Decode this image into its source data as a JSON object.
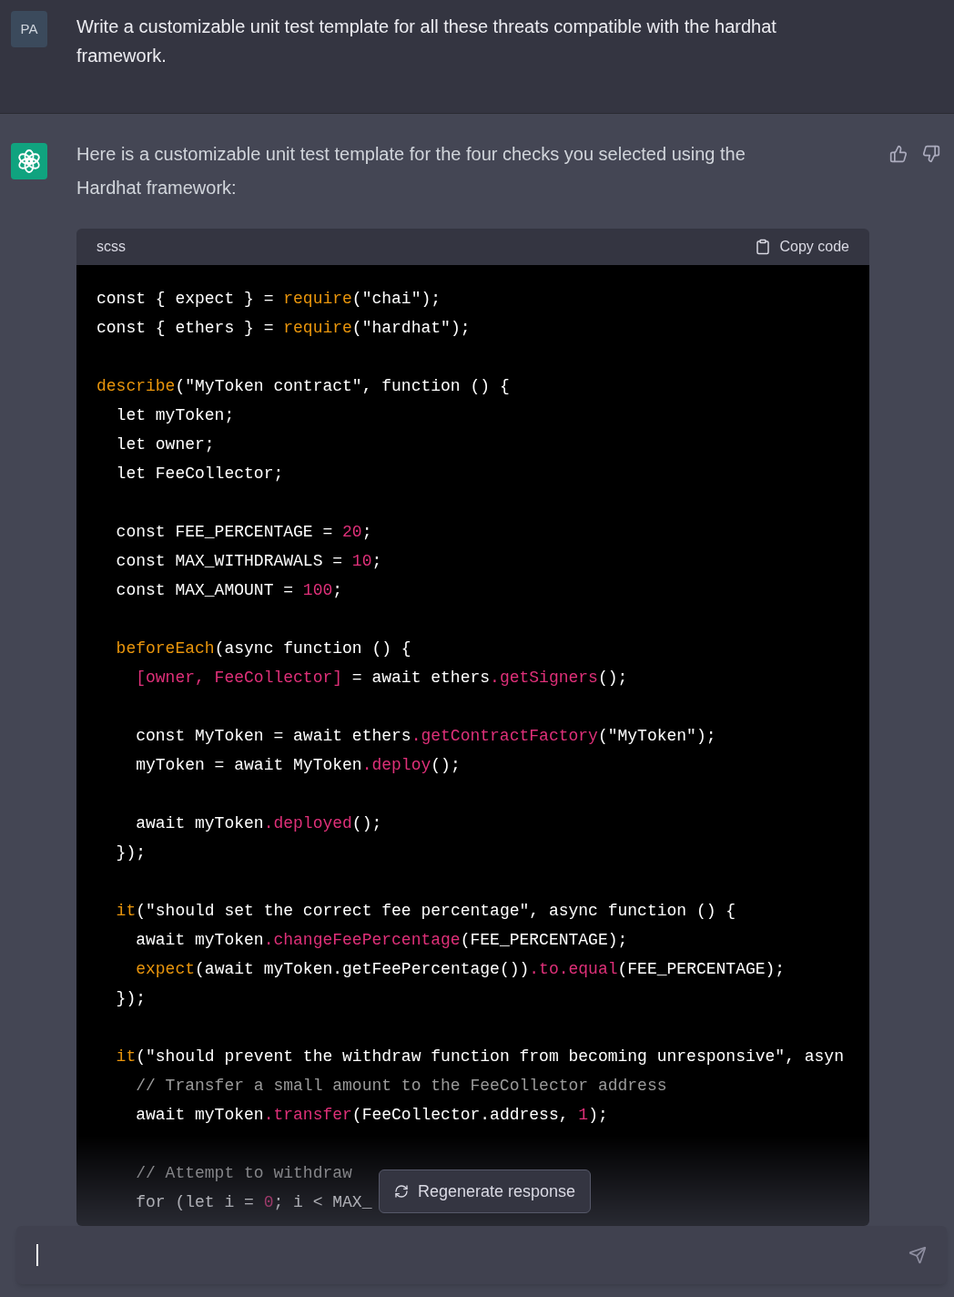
{
  "user_message": {
    "avatar": "PA",
    "text": "Write a customizable unit test template for all these threats compatible with the hardhat framework."
  },
  "assistant_message": {
    "text": "Here is a customizable unit test template for the four checks you selected using the Hardhat framework:",
    "code_block": {
      "language": "scss",
      "copy_label": "Copy code",
      "lines": [
        {
          "kind": "code",
          "tokens": [
            {
              "kind": "plain",
              "text": "const { expect } = "
            },
            {
              "kind": "fn",
              "text": "require"
            },
            {
              "kind": "plain",
              "text": "(\"chai\");"
            }
          ]
        },
        {
          "kind": "code",
          "tokens": [
            {
              "kind": "plain",
              "text": "const { ethers } = "
            },
            {
              "kind": "fn",
              "text": "require"
            },
            {
              "kind": "plain",
              "text": "(\"hardhat\");"
            }
          ]
        },
        {
          "kind": "blank"
        },
        {
          "kind": "code",
          "tokens": [
            {
              "kind": "fn",
              "text": "describe"
            },
            {
              "kind": "plain",
              "text": "(\"MyToken contract\", function () {"
            }
          ]
        },
        {
          "kind": "code",
          "tokens": [
            {
              "kind": "plain",
              "text": "  let myToken;"
            }
          ]
        },
        {
          "kind": "code",
          "tokens": [
            {
              "kind": "plain",
              "text": "  let owner;"
            }
          ]
        },
        {
          "kind": "code",
          "tokens": [
            {
              "kind": "plain",
              "text": "  let FeeCollector;"
            }
          ]
        },
        {
          "kind": "blank"
        },
        {
          "kind": "code",
          "tokens": [
            {
              "kind": "plain",
              "text": "  const FEE_PERCENTAGE = "
            },
            {
              "kind": "num",
              "text": "20"
            },
            {
              "kind": "plain",
              "text": ";"
            }
          ]
        },
        {
          "kind": "code",
          "tokens": [
            {
              "kind": "plain",
              "text": "  const MAX_WITHDRAWALS = "
            },
            {
              "kind": "num",
              "text": "10"
            },
            {
              "kind": "plain",
              "text": ";"
            }
          ]
        },
        {
          "kind": "code",
          "tokens": [
            {
              "kind": "plain",
              "text": "  const MAX_AMOUNT = "
            },
            {
              "kind": "num",
              "text": "100"
            },
            {
              "kind": "plain",
              "text": ";"
            }
          ]
        },
        {
          "kind": "blank"
        },
        {
          "kind": "code",
          "tokens": [
            {
              "kind": "fn",
              "text": "  beforeEach"
            },
            {
              "kind": "plain",
              "text": "(async function () {"
            }
          ]
        },
        {
          "kind": "code",
          "tokens": [
            {
              "kind": "prop",
              "text": "    [owner, FeeCollector]"
            },
            {
              "kind": "plain",
              "text": " = await ethers"
            },
            {
              "kind": "prop",
              "text": ".getSigners"
            },
            {
              "kind": "plain",
              "text": "();"
            }
          ]
        },
        {
          "kind": "blank"
        },
        {
          "kind": "code",
          "tokens": [
            {
              "kind": "plain",
              "text": "    const MyToken = await ethers"
            },
            {
              "kind": "prop",
              "text": ".getContractFactory"
            },
            {
              "kind": "plain",
              "text": "(\"MyToken\");"
            }
          ]
        },
        {
          "kind": "code",
          "tokens": [
            {
              "kind": "plain",
              "text": "    myToken = await MyToken"
            },
            {
              "kind": "prop",
              "text": ".deploy"
            },
            {
              "kind": "plain",
              "text": "();"
            }
          ]
        },
        {
          "kind": "blank"
        },
        {
          "kind": "code",
          "tokens": [
            {
              "kind": "plain",
              "text": "    await myToken"
            },
            {
              "kind": "prop",
              "text": ".deployed"
            },
            {
              "kind": "plain",
              "text": "();"
            }
          ]
        },
        {
          "kind": "code",
          "tokens": [
            {
              "kind": "plain",
              "text": "  });"
            }
          ]
        },
        {
          "kind": "blank"
        },
        {
          "kind": "code",
          "tokens": [
            {
              "kind": "fn",
              "text": "  it"
            },
            {
              "kind": "plain",
              "text": "(\"should set the correct fee percentage\", async function () {"
            }
          ]
        },
        {
          "kind": "code",
          "tokens": [
            {
              "kind": "plain",
              "text": "    await myToken"
            },
            {
              "kind": "prop",
              "text": ".changeFeePercentage"
            },
            {
              "kind": "plain",
              "text": "(FEE_PERCENTAGE);"
            }
          ]
        },
        {
          "kind": "code",
          "tokens": [
            {
              "kind": "fn",
              "text": "    expect"
            },
            {
              "kind": "plain",
              "text": "(await myToken.getFeePercentage())"
            },
            {
              "kind": "prop",
              "text": ".to.equal"
            },
            {
              "kind": "plain",
              "text": "(FEE_PERCENTAGE);"
            }
          ]
        },
        {
          "kind": "code",
          "tokens": [
            {
              "kind": "plain",
              "text": "  });"
            }
          ]
        },
        {
          "kind": "blank"
        },
        {
          "kind": "code",
          "tokens": [
            {
              "kind": "fn",
              "text": "  it"
            },
            {
              "kind": "plain",
              "text": "(\"should prevent the withdraw function from becoming unresponsive\", asyn"
            }
          ]
        },
        {
          "kind": "code",
          "tokens": [
            {
              "kind": "comment",
              "text": "    // Transfer a small amount to the FeeCollector address"
            }
          ]
        },
        {
          "kind": "code",
          "tokens": [
            {
              "kind": "plain",
              "text": "    await myToken"
            },
            {
              "kind": "prop",
              "text": ".transfer"
            },
            {
              "kind": "plain",
              "text": "(FeeCollector.address, "
            },
            {
              "kind": "num",
              "text": "1"
            },
            {
              "kind": "plain",
              "text": ");"
            }
          ]
        },
        {
          "kind": "blank"
        },
        {
          "kind": "code",
          "tokens": [
            {
              "kind": "comment",
              "text": "    // Attempt to withdraw"
            }
          ]
        },
        {
          "kind": "code",
          "tokens": [
            {
              "kind": "plain",
              "text": "    for (let i = "
            },
            {
              "kind": "num",
              "text": "0"
            },
            {
              "kind": "plain",
              "text": "; i < MAX_"
            }
          ]
        }
      ]
    }
  },
  "regenerate_button": {
    "label": "Regenerate response"
  }
}
